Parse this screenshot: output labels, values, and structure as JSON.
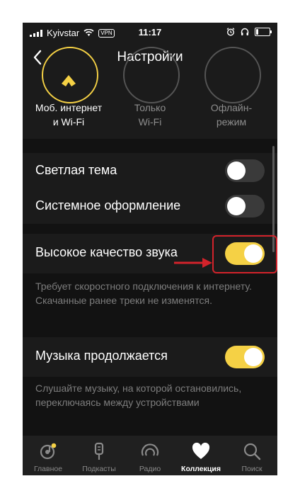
{
  "status_bar": {
    "carrier": "Kyivstar",
    "vpn": "VPN",
    "time": "11:17",
    "battery_level": 0.15
  },
  "header": {
    "title": "Настройки"
  },
  "network_options": [
    {
      "label": "Моб. интернет\nи Wi-Fi",
      "selected": true
    },
    {
      "label": "Только\nWi-Fi",
      "selected": false
    },
    {
      "label": "Офлайн-\nрежим",
      "selected": false
    }
  ],
  "settings": {
    "light_theme": {
      "label": "Светлая тема",
      "enabled": false
    },
    "system_theme": {
      "label": "Системное оформление",
      "enabled": false
    },
    "high_quality": {
      "label": "Высокое качество звука",
      "enabled": true,
      "description": "Требует скоростного подключения к интернету. Скачанные ранее треки не изменятся."
    },
    "music_continues": {
      "label": "Музыка продолжается",
      "enabled": true,
      "description": "Слушайте музыку, на которой остановились, переключаясь между устройствами"
    }
  },
  "tabs": [
    {
      "label": "Главное",
      "icon": "home-icon",
      "active": false
    },
    {
      "label": "Подкасты",
      "icon": "microphone-icon",
      "active": false
    },
    {
      "label": "Радио",
      "icon": "radio-icon",
      "active": false
    },
    {
      "label": "Коллекция",
      "icon": "heart-icon",
      "active": true
    },
    {
      "label": "Поиск",
      "icon": "search-icon",
      "active": false
    }
  ],
  "colors": {
    "accent": "#f5d145",
    "background": "#1b1b1b",
    "annotation": "#d3232b"
  }
}
